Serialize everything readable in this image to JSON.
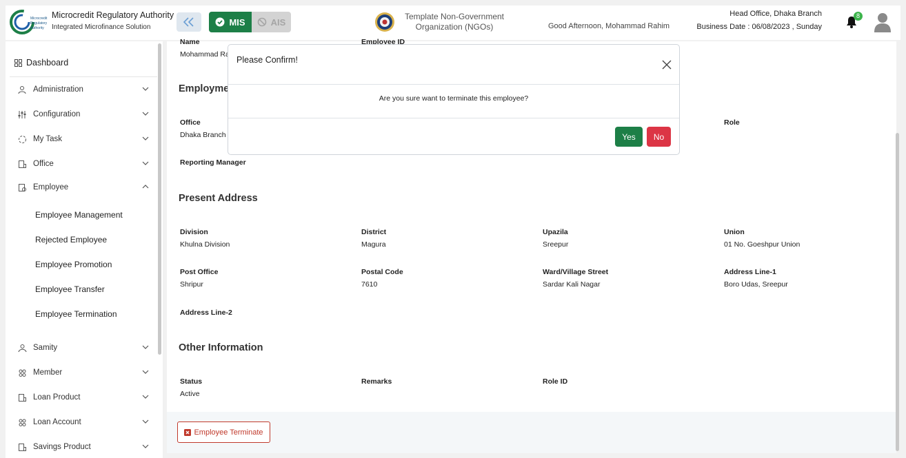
{
  "header": {
    "brand_title": "Microcredit Regulatory Authority",
    "brand_subtitle": "Integrated Microfinance Solution",
    "logo_text": "Microcredit Regulatory Authority",
    "mis_label": "MIS",
    "ais_label": "AIS",
    "org_name": "Template Non-Government Organization (NGOs)",
    "greeting": "Good Afternoon, Mohammad Rahim",
    "branch": "Head Office, Dhaka Branch",
    "business_date": "Business Date : 06/08/2023 , Sunday",
    "notification_count": "8",
    "accent": "#1d7f47"
  },
  "sidebar": {
    "dashboard": "Dashboard",
    "items": [
      {
        "label": "Administration",
        "icon": "users-cog-icon"
      },
      {
        "label": "Configuration",
        "icon": "sliders-icon"
      },
      {
        "label": "My Task",
        "icon": "spinner-icon"
      },
      {
        "label": "Office",
        "icon": "building-icon"
      },
      {
        "label": "Employee",
        "icon": "id-card-icon"
      },
      {
        "label": "Samity",
        "icon": "group-icon"
      },
      {
        "label": "Member",
        "icon": "members-icon"
      },
      {
        "label": "Loan Product",
        "icon": "document-icon"
      },
      {
        "label": "Loan Account",
        "icon": "account-icon"
      },
      {
        "label": "Savings Product",
        "icon": "document-icon"
      }
    ],
    "employee_sub": [
      "Employee Management",
      "Rejected Employee",
      "Employee Promotion",
      "Employee Transfer",
      "Employee Termination"
    ]
  },
  "main": {
    "name_label": "Name",
    "name_value": "Mohammad Ra",
    "employee_id_label": "Employee ID",
    "employment_heading": "Employme",
    "office_label": "Office",
    "office_value": "Dhaka Branch",
    "role_label": "Role",
    "reporting_manager_label": "Reporting Manager",
    "present_address_heading": "Present Address",
    "division_label": "Division",
    "division_value": "Khulna Division",
    "district_label": "District",
    "district_value": "Magura",
    "upazila_label": "Upazila",
    "upazila_value": "Sreepur",
    "union_label": "Union",
    "union_value": "01 No. Goeshpur Union",
    "post_office_label": "Post Office",
    "post_office_value": "Shripur",
    "postal_code_label": "Postal Code",
    "postal_code_value": "7610",
    "ward_label": "Ward/Village Street",
    "ward_value": "Sardar Kali Nagar",
    "address1_label": "Address Line-1",
    "address1_value": "Boro Udas, Sreepur",
    "address2_label": "Address Line-2",
    "other_heading": "Other Information",
    "status_label": "Status",
    "status_value": "Active",
    "remarks_label": "Remarks",
    "role_id_label": "Role ID",
    "terminate_button": "Employee Terminate"
  },
  "modal": {
    "title": "Please Confirm!",
    "message": "Are you sure want to terminate this employee?",
    "yes": "Yes",
    "no": "No"
  }
}
